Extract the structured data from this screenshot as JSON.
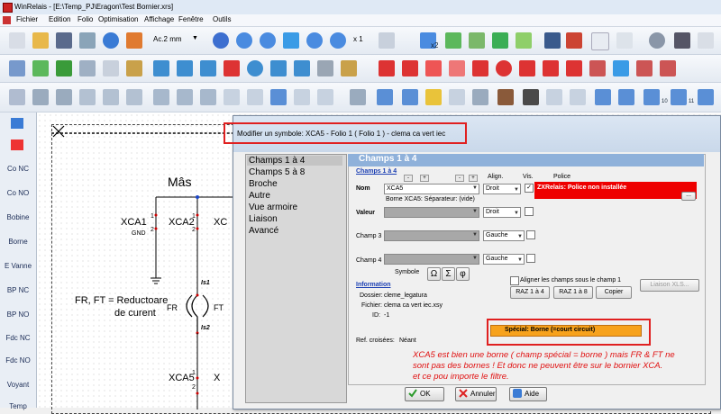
{
  "window": {
    "title": "WinRelais - [E:\\Temp_PJ\\Eragon\\Test Bornier.xrs]"
  },
  "menu": [
    "Fichier",
    "Edition",
    "Folio",
    "Optimisation",
    "Affichage",
    "Fenêtre",
    "Outils"
  ],
  "toolbar": {
    "paper_size": "Ac.2 mm",
    "zoom": "x 1",
    "icon_labels": [
      "x2",
      "10",
      "11"
    ]
  },
  "palette": {
    "items": [
      "Co NC",
      "Co NO",
      "Bobine",
      "Borne",
      "E Vanne",
      "BP NC",
      "BP NO",
      "Fdc NC",
      "Fdc NO",
      "Voyant",
      "Temp"
    ]
  },
  "canvas": {
    "heading": "Mâs",
    "labels": {
      "xca1": "XCA1",
      "gnd": "GND",
      "xca2": "XCA2",
      "xc": "XC",
      "fr_ft_text_1": "FR, FT = Reductoare",
      "fr_ft_text_2": "de curent",
      "fr": "FR",
      "ft": "FT",
      "is1": "Is1",
      "is2": "Is2",
      "xca5": "XCA5",
      "x": "X",
      "pin1a": "1",
      "pin2a": "2",
      "pin1b": "1",
      "pin2b": "2",
      "pin1c": "1",
      "pin2c": "2"
    }
  },
  "dialog": {
    "title": "Modifier un symbole: XCA5 - Folio 1 ( Folio 1 ) - clema ca vert iec",
    "list": [
      "Champs 1 à 4",
      "Champs 5 à 8",
      "Broche",
      "Autre",
      "Vue armoire",
      "Liaison",
      "Avancé"
    ],
    "panel_title": "Champs 1 à 4",
    "link_champs": "Champs 1 à 4",
    "col_align": "Align.",
    "col_vis": "Vis.",
    "col_police": "Police",
    "nom_label": "Nom",
    "nom_value": "XCA5",
    "nom_align": "Droit",
    "nom_hint": "Borne XCA5: Séparateur: (vide)",
    "police_warning": "ZXRelais: Police non installée",
    "police_btn": "...",
    "valeur_label": "Valeur",
    "valeur_align": "Droit",
    "champ3_label": "Champ 3",
    "champ3_align": "Gauche",
    "champ4_label": "Champ 4",
    "champ4_align": "Gauche",
    "symbole_label": "Symbole",
    "symbols": [
      "Ω",
      "Σ",
      "φ"
    ],
    "aligner_label": "Aligner les champs sous le champ 1",
    "btn_raz14": "RAZ 1 à 4",
    "btn_raz18": "RAZ 1 à 8",
    "btn_copier": "Copier",
    "btn_liaison": "Liaison XLS...",
    "info_link": "Information",
    "dossier_label": "Dossier:",
    "dossier_value": "cleme_legatura",
    "fichier_label": "Fichier:",
    "fichier_value": "clema ca vert iec.xsy",
    "id_label": "ID:",
    "id_value": "-1",
    "ref_label": "Ref. croisées:",
    "ref_value": "Néant",
    "special": "Spécial: Borne (=court circuit)",
    "btn_ok": "OK",
    "btn_annuler": "Annuler",
    "btn_aide": "Aide",
    "check_mark": "✓",
    "mini_left": "-",
    "mini_right": "+",
    "arrow": "▼"
  },
  "annotation": {
    "line1": "XCA5 est bien une borne ( champ spécial = borne ) mais FR & FT ne",
    "line2": "sont pas des bornes ! Et donc ne peuvent être sur le bornier XCA.",
    "line3": "et ce pou importe le filtre."
  },
  "colors": {
    "accent_red": "#ee0000",
    "special_orange": "#f7a21c",
    "panel_blue": "#8fb1da",
    "annotation_red": "#e01010"
  }
}
